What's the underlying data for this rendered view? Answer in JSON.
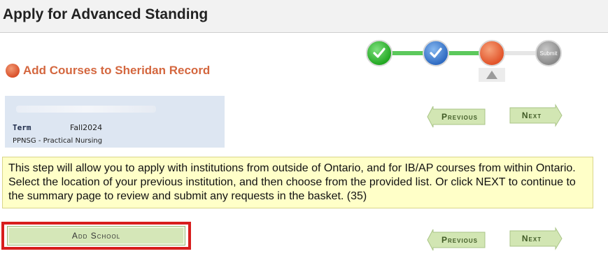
{
  "header": {
    "title": "Apply for Advanced Standing"
  },
  "progress": {
    "steps": [
      {
        "state": "complete",
        "icon": "checkmark-icon",
        "color": "#23a823"
      },
      {
        "state": "complete",
        "icon": "checkmark-icon",
        "color": "#2f6bc2"
      },
      {
        "state": "current",
        "color": "#e2542a"
      },
      {
        "state": "pending",
        "label": "Submit",
        "color": "#8a8a8a"
      }
    ],
    "line_complete_color": "#5cc95c",
    "line_pending_color": "#e6e6e6"
  },
  "section": {
    "title": "Add Courses to Sheridan Record",
    "color": "#d4673f"
  },
  "info": {
    "term_label": "Term",
    "term_value": "Fall2024",
    "program": "PPNSG - Practical Nursing"
  },
  "nav_top": {
    "previous": "Previous",
    "next": "Next"
  },
  "message": "This step will allow you to apply with institutions from outside of Ontario, and for IB/AP courses from within Ontario. Select the location of your previous institution, and then choose from the provided list. Or click NEXT to continue to the summary page to review and submit any requests in the basket. (35)",
  "actions": {
    "add_school": "Add School",
    "highlight_color": "#d81e1e"
  },
  "nav_bottom": {
    "previous": "Previous",
    "next": "Next"
  }
}
